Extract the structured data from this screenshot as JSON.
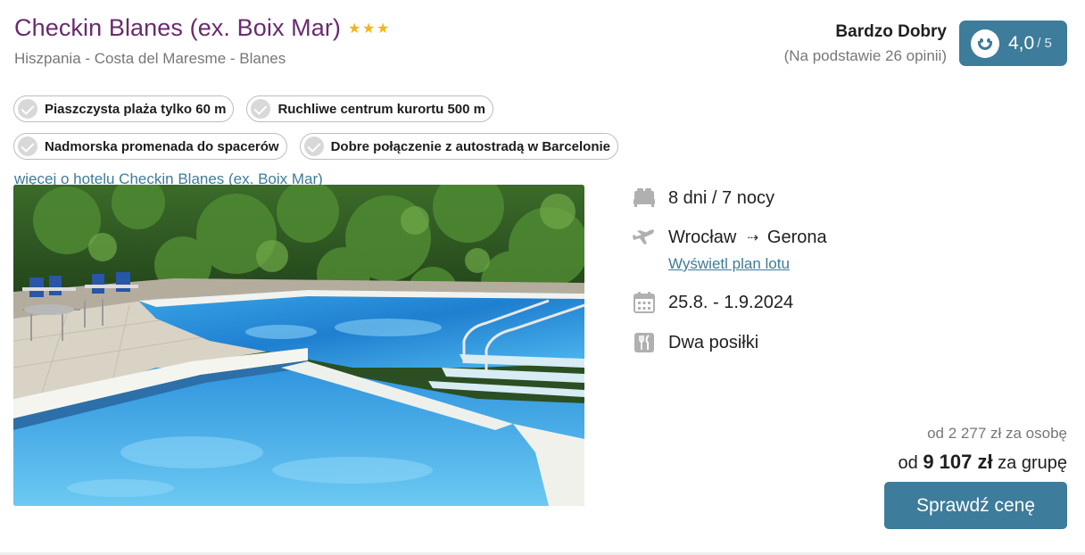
{
  "hotel": {
    "name": "Checkin Blanes (ex. Boix Mar)",
    "stars": 3,
    "location": "Hiszpania - Costa del Maresme - Blanes"
  },
  "rating": {
    "label": "Bardzo Dobry",
    "basis": "(Na podstawie 26 opinii)",
    "score": "4,0",
    "max": "/ 5",
    "icon": "smile-face-icon"
  },
  "tags": [
    "Piaszczysta plaża tylko 60 m",
    "Ruchliwe centrum kurortu 500 m",
    "Nadmorska promenada do spacerów",
    "Dobre połączenie z autostradą w Barcelonie"
  ],
  "more_link": "więcej o hotelu Checkin Blanes (ex. Boix Mar)",
  "details": {
    "duration": "8 dni / 7 nocy",
    "from": "Wrocław",
    "arrow": "⇢",
    "to": "Gerona",
    "flight_plan_link": "Wyświetl plan lotu",
    "dates": "25.8. - 1.9.2024",
    "board": "Dwa posiłki"
  },
  "price": {
    "per_person": "od 2 277 zł za osobę",
    "group_prefix": "od ",
    "group_amount": "9 107 zł",
    "group_suffix": " za grupę"
  },
  "cta_label": "Sprawdź cenę",
  "colors": {
    "title": "#6a2a6e",
    "accent": "#3d7c9a",
    "star": "#f3b51b"
  }
}
